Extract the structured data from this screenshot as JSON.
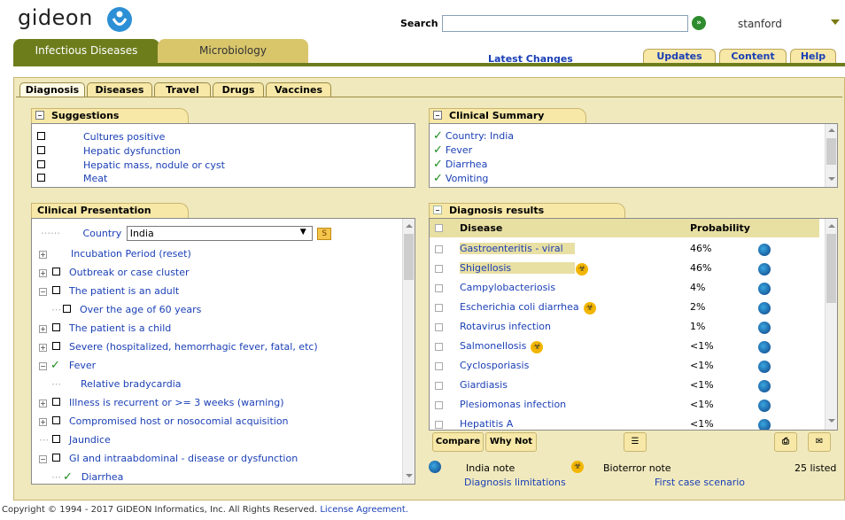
{
  "header": {
    "logo_text": "gideon",
    "search_label": "Search",
    "search_value": "",
    "search_go": "»",
    "user": "stanford"
  },
  "modules": [
    "Infectious Diseases",
    "Microbiology"
  ],
  "top_links": {
    "latest_changes": "Latest Changes",
    "updates": "Updates",
    "content": "Content",
    "help": "Help"
  },
  "subtabs": [
    "Diagnosis",
    "Diseases",
    "Travel",
    "Drugs",
    "Vaccines"
  ],
  "suggestions": {
    "title": "Suggestions",
    "items": [
      "Cultures positive",
      "Hepatic dysfunction",
      "Hepatic mass, nodule or cyst",
      "Meat"
    ]
  },
  "clinical_summary": {
    "title": "Clinical Summary",
    "items": [
      "Country: India",
      "Fever",
      "Diarrhea",
      "Vomiting"
    ]
  },
  "clinical_presentation": {
    "title": "Clinical Presentation",
    "country_label": "Country",
    "country_value": "India",
    "country_button": "S",
    "items": [
      "Incubation Period (reset)",
      "Outbreak or case cluster",
      "The patient is an adult",
      "Over the age of 60 years",
      "The patient is a child",
      "Severe (hospitalized, hemorrhagic fever, fatal, etc)",
      "Fever",
      "Relative bradycardia",
      "Illness is recurrent or >= 3 weeks (warning)",
      "Compromised host or nosocomial acquisition",
      "Jaundice",
      "GI and intraabdominal - disease or dysfunction",
      "Diarrhea"
    ]
  },
  "diagnosis_results": {
    "title": "Diagnosis results",
    "col_disease": "Disease",
    "col_probability": "Probability",
    "rows": [
      {
        "disease": "Gastroenteritis - viral",
        "prob": "46%",
        "bio": false
      },
      {
        "disease": "Shigellosis",
        "prob": "46%",
        "bio": true
      },
      {
        "disease": "Campylobacteriosis",
        "prob": "4%",
        "bio": false
      },
      {
        "disease": "Escherichia coli diarrhea",
        "prob": "2%",
        "bio": true
      },
      {
        "disease": "Rotavirus infection",
        "prob": "1%",
        "bio": false
      },
      {
        "disease": "Salmonellosis",
        "prob": "<1%",
        "bio": true
      },
      {
        "disease": "Cyclosporiasis",
        "prob": "<1%",
        "bio": false
      },
      {
        "disease": "Giardiasis",
        "prob": "<1%",
        "bio": false
      },
      {
        "disease": "Plesiomonas infection",
        "prob": "<1%",
        "bio": false
      },
      {
        "disease": "Hepatitis A",
        "prob": "<1%",
        "bio": false
      }
    ],
    "compare": "Compare",
    "why_not": "Why Not",
    "india_note": "India note",
    "bioterror_note": "Bioterror note",
    "listed": "25 listed",
    "diag_limitations": "Diagnosis limitations",
    "first_case": "First case scenario"
  },
  "footer": {
    "copyright": "Copyright © 1994 - 2017 GIDEON Informatics, Inc. All Rights Reserved.",
    "license": "License Agreement."
  }
}
